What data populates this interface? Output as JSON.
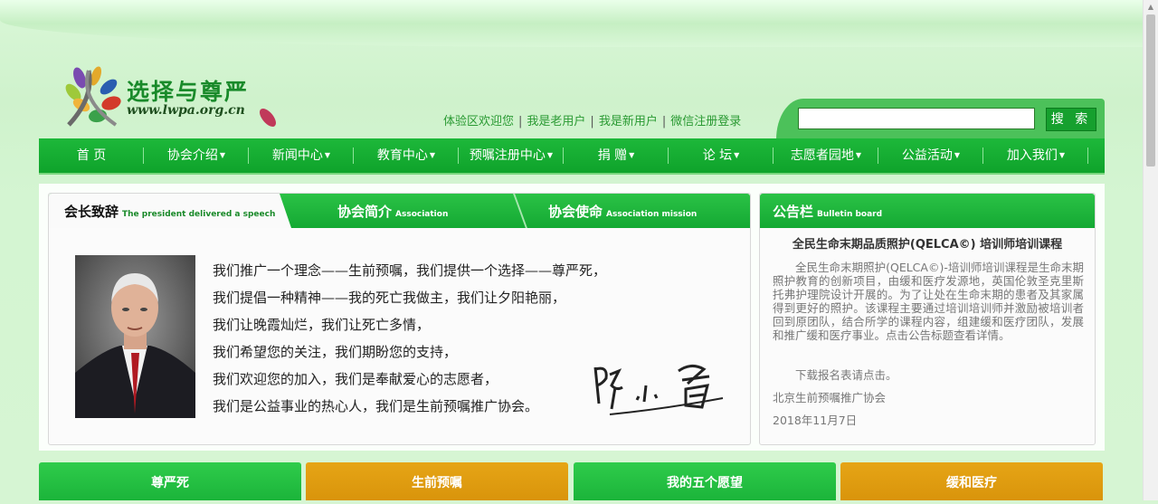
{
  "site": {
    "name": "选择与尊严",
    "url": "www.lwpa.org.cn"
  },
  "user_links": {
    "trial": "体验区欢迎您",
    "old_user": "我是老用户",
    "new_user": "我是新用户",
    "wechat": "微信注册登录"
  },
  "search": {
    "placeholder": "",
    "button": "搜 索"
  },
  "nav": [
    {
      "label": "首 页",
      "dropdown": false
    },
    {
      "label": "协会介绍",
      "dropdown": true
    },
    {
      "label": "新闻中心",
      "dropdown": true
    },
    {
      "label": "教育中心",
      "dropdown": true
    },
    {
      "label": "预嘱注册中心",
      "dropdown": true
    },
    {
      "label": "捐 赠",
      "dropdown": true
    },
    {
      "label": "论 坛",
      "dropdown": true
    },
    {
      "label": "志愿者园地",
      "dropdown": true
    },
    {
      "label": "公益活动",
      "dropdown": true
    },
    {
      "label": "加入我们",
      "dropdown": true
    }
  ],
  "tabs": [
    {
      "label": "会长致辞",
      "sub": "The president delivered a speech",
      "active": true
    },
    {
      "label": "协会简介",
      "sub": "Association",
      "active": false
    },
    {
      "label": "协会使命",
      "sub": "Association mission",
      "active": false
    }
  ],
  "speech": [
    "我们推广一个理念——生前预嘱，我们提供一个选择——尊严死，",
    "我们提倡一种精神——我的死亡我做主，我们让夕阳艳丽，",
    "我们让晚霞灿烂，我们让死亡多情，",
    "我们希望您的关注，我们期盼您的支持，",
    "我们欢迎您的加入，我们是奉献爱心的志愿者，",
    "我们是公益事业的热心人，我们是生前预嘱推广协会。"
  ],
  "bulletin": {
    "title": "公告栏",
    "sub": "Bulletin board",
    "heading": "全民生命末期品质照护(QELCA©) 培训师培训课程",
    "body": "全民生命末期照护(QELCA©)-培训师培训课程是生命末期照护教育的创新项目，由缓和医疗发源地，英国伦敦圣克里斯托弗护理院设计开展的。为了让处在生命末期的患者及其家属得到更好的照护。该课程主要通过培训培训师并激励被培训者回到原团队，结合所学的课程内容，组建缓和医疗团队，发展和推广缓和医疗事业。点击公告标题查看详情。",
    "download": "下载报名表请点击。",
    "org": "北京生前预嘱推广协会",
    "date": "2018年11月7日"
  },
  "tiles": [
    "尊严死",
    "生前预嘱",
    "我的五个愿望",
    "缓和医疗"
  ],
  "colors": {
    "primary": "#1db83a",
    "accent": "#e6a516",
    "background": "#d6f5d3"
  }
}
